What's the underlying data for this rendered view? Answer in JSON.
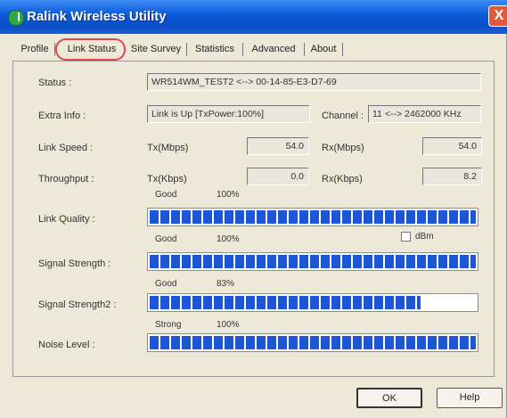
{
  "window": {
    "title": "Ralink Wireless Utility",
    "close_symbol": "X"
  },
  "tabs": [
    {
      "label": "Profile",
      "active": false
    },
    {
      "label": "Link Status",
      "active": true
    },
    {
      "label": "Site Survey",
      "active": false
    },
    {
      "label": "Statistics",
      "active": false
    },
    {
      "label": "Advanced",
      "active": false
    },
    {
      "label": "About",
      "active": false
    }
  ],
  "status": {
    "label": "Status :",
    "value": "WR514WM_TEST2 <--> 00-14-85-E3-D7-69"
  },
  "extra_info": {
    "label": "Extra Info :",
    "value": "Link is Up [TxPower:100%]",
    "channel_label": "Channel :",
    "channel_value": "11 <--> 2462000 KHz"
  },
  "link_speed": {
    "label": "Link Speed :",
    "tx_label": "Tx(Mbps)",
    "tx_value": "54.0",
    "rx_label": "Rx(Mbps)",
    "rx_value": "54.0"
  },
  "throughput": {
    "label": "Throughput :",
    "tx_label": "Tx(Kbps)",
    "tx_value": "0.0",
    "rx_label": "Rx(Kbps)",
    "rx_value": "8.2"
  },
  "link_quality": {
    "label": "Link Quality :",
    "rating": "Good",
    "percent_text": "100%",
    "level": 1.0
  },
  "signal_strength": {
    "label": "Signal Strength :",
    "rating": "Good",
    "percent_text": "100%",
    "level": 1.0,
    "dbm_label": "dBm",
    "dbm_checked": false
  },
  "signal_strength2": {
    "label": "Signal Strength2 :",
    "rating": "Good",
    "percent_text": "83%",
    "level": 0.83
  },
  "noise_level": {
    "label": "Noise Level :",
    "rating": "Strong",
    "percent_text": "100%",
    "level": 1.0
  },
  "buttons": {
    "ok_label": "OK",
    "help_label": "Help"
  },
  "colors": {
    "titlebar": "#0c4fc7",
    "bar_fill": "#1a56d6",
    "window_bg": "#ece9d8",
    "tab_highlight": "#e04848"
  }
}
